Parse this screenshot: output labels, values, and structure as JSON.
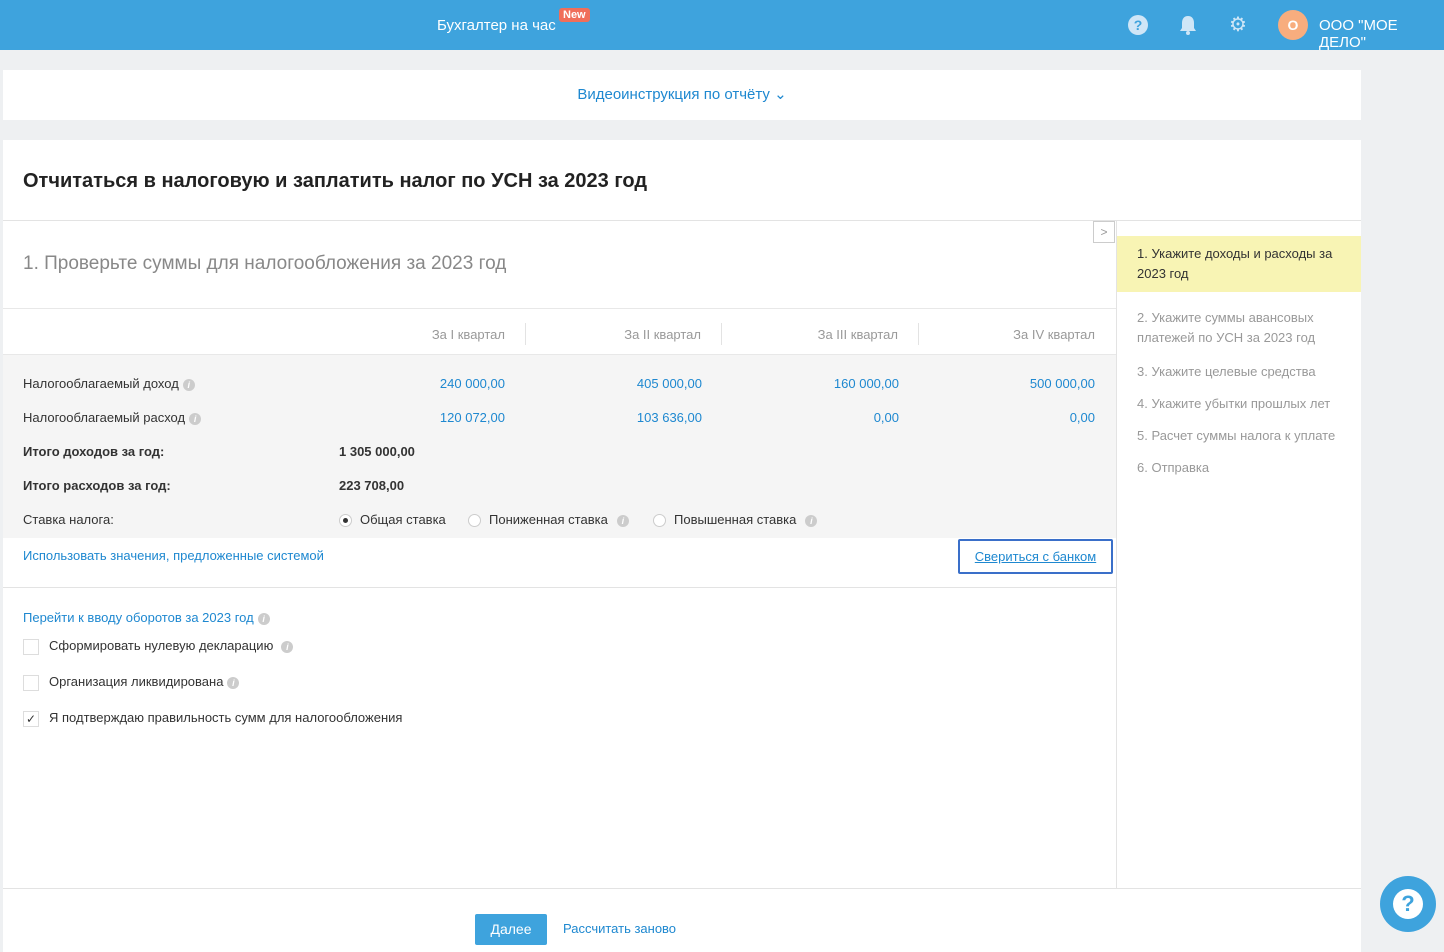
{
  "header": {
    "brand": "Бухгалтер на час",
    "badge": "New",
    "avatar_letter": "О",
    "org": "ООО \"МОЕ ДЕЛО\""
  },
  "video": {
    "label": "Видеоинструкция по отчёту"
  },
  "page": {
    "title": "Отчитаться в налоговую и заплатить налог по УСН за 2023 год",
    "section": "1. Проверьте суммы для налогообложения за 2023 год"
  },
  "table": {
    "columns": [
      "За I квартал",
      "За II квартал",
      "За III квартал",
      "За IV квартал"
    ],
    "income_label": "Налогооблагаемый доход",
    "income": [
      "240 000,00",
      "405 000,00",
      "160 000,00",
      "500 000,00"
    ],
    "expense_label": "Налогооблагаемый расход",
    "expense": [
      "120 072,00",
      "103 636,00",
      "0,00",
      "0,00"
    ],
    "total_income_label": "Итого доходов за год:",
    "total_income": "1 305 000,00",
    "total_expense_label": "Итого расходов за год:",
    "total_expense": "223 708,00",
    "rate_label": "Ставка налога:",
    "rates": [
      "Общая ставка",
      "Пониженная ставка",
      "Повышенная ставка"
    ]
  },
  "links": {
    "use_system": "Использовать значения, предложенные системой",
    "bank": "Свериться с банком",
    "turnover": "Перейти к вводу оборотов за 2023 год"
  },
  "checks": [
    {
      "label": "Сформировать нулевую декларацию",
      "checked": false
    },
    {
      "label": "Организация ликвидирована",
      "checked": false
    },
    {
      "label": "Я подтверждаю правильность сумм для налогообложения",
      "checked": true
    }
  ],
  "steps": [
    "1.   Укажите доходы и расходы за 2023 год",
    "2.   Укажите суммы авансовых платежей по УСН за 2023 год",
    "3.   Укажите целевые средства",
    "4.   Укажите убытки прошлых лет",
    "5.   Расчет суммы налога к уплате",
    "6.   Отправка"
  ],
  "footer": {
    "next": "Далее",
    "recalc": "Рассчитать заново"
  },
  "colors": {
    "accent": "#3ea3dd",
    "link": "#1e88d0",
    "badge": "#f06e5a",
    "active_step": "#f8f4b4"
  }
}
